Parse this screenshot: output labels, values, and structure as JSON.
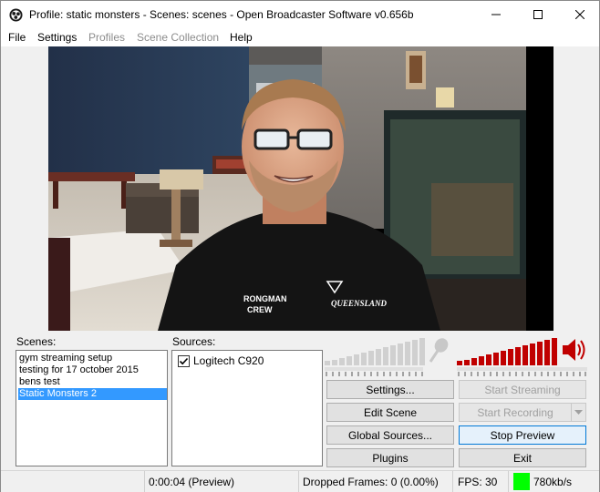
{
  "window": {
    "title": "Profile: static monsters - Scenes: scenes - Open Broadcaster Software v0.656b"
  },
  "menu": {
    "items": [
      {
        "label": "File",
        "disabled": false
      },
      {
        "label": "Settings",
        "disabled": false
      },
      {
        "label": "Profiles",
        "disabled": true
      },
      {
        "label": "Scene Collection",
        "disabled": true
      },
      {
        "label": "Help",
        "disabled": false
      }
    ]
  },
  "preview": {
    "shirt_text_left": "RONGMAN",
    "shirt_text_left2": "CREW",
    "shirt_logo": "QUEENSLAND"
  },
  "scenes": {
    "label": "Scenes:",
    "items": [
      {
        "label": "gym streaming setup",
        "selected": false
      },
      {
        "label": "testing for 17 october 2015",
        "selected": false
      },
      {
        "label": "bens test",
        "selected": false
      },
      {
        "label": "Static Monsters 2",
        "selected": true
      }
    ]
  },
  "sources": {
    "label": "Sources:",
    "items": [
      {
        "label": "Logitech C920",
        "checked": true
      }
    ]
  },
  "meters": {
    "mic_icon": "microphone-icon",
    "speaker_icon": "speaker-icon",
    "mic_color": "#d0d0d0",
    "desktop_color": "#c00000"
  },
  "buttons": {
    "settings": "Settings...",
    "start_streaming": "Start Streaming",
    "edit_scene": "Edit Scene",
    "start_recording": "Start Recording",
    "global_sources": "Global Sources...",
    "stop_preview": "Stop Preview",
    "plugins": "Plugins",
    "exit": "Exit"
  },
  "status": {
    "time": "0:00:04 (Preview)",
    "dropped_frames": "Dropped Frames: 0 (0.00%)",
    "fps": "FPS: 30",
    "bitrate": "780kb/s",
    "indicator_color": "#00ff00"
  }
}
